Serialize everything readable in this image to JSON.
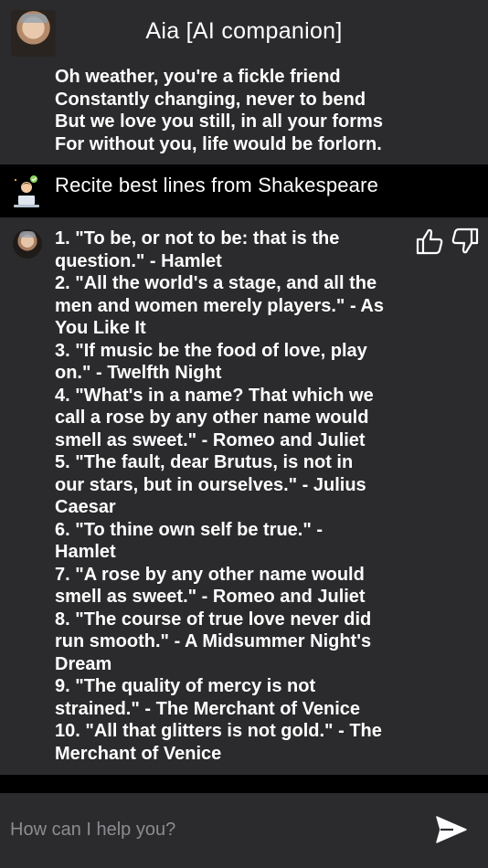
{
  "header": {
    "title": "Aia [AI companion]",
    "avatar_icon": "ai-companion-avatar"
  },
  "messages": {
    "previous_ai": {
      "lines": [
        "Oh weather, you're a fickle friend",
        "Constantly changing, never to bend",
        "But we love you still, in all your forms",
        "For without you, life would be forlorn."
      ]
    },
    "user": {
      "text": "Recite best lines from Shakespeare",
      "avatar_icon": "user-laptop-avatar"
    },
    "ai_reply": {
      "lines": [
        "1. \"To be, or not to be: that is the",
        "question.\" - Hamlet",
        "2. \"All the world's a stage, and all the",
        "men and women merely players.\" - As",
        "You Like It",
        "3. \"If music be the food of love, play",
        "on.\" - Twelfth Night",
        "4. \"What's in a name? That which we",
        "call a rose by any other name would",
        "smell as sweet.\" - Romeo and Juliet",
        "5. \"The fault, dear Brutus, is not in",
        "our stars, but in ourselves.\" - Julius",
        "Caesar",
        "6. \"To thine own self be true.\" -",
        "Hamlet",
        "7. \"A rose by any other name would",
        "smell as sweet.\" - Romeo and Juliet",
        "8. \"The course of true love never did",
        "run smooth.\" - A Midsummer Night's",
        "Dream",
        "9. \"The quality of mercy is not",
        "strained.\" - The Merchant of Venice",
        "10. \"All that glitters is not gold.\" - The",
        "Merchant of Venice"
      ],
      "feedback_icons": [
        "thumbs-up-icon",
        "thumbs-down-icon"
      ]
    }
  },
  "input": {
    "placeholder": "How can I help you?",
    "value": "",
    "send_icon": "send-icon"
  },
  "colors": {
    "background": "#2b2b2d",
    "user_message_background": "#000000",
    "text": "#ffffff",
    "placeholder": "#8c8c90"
  }
}
